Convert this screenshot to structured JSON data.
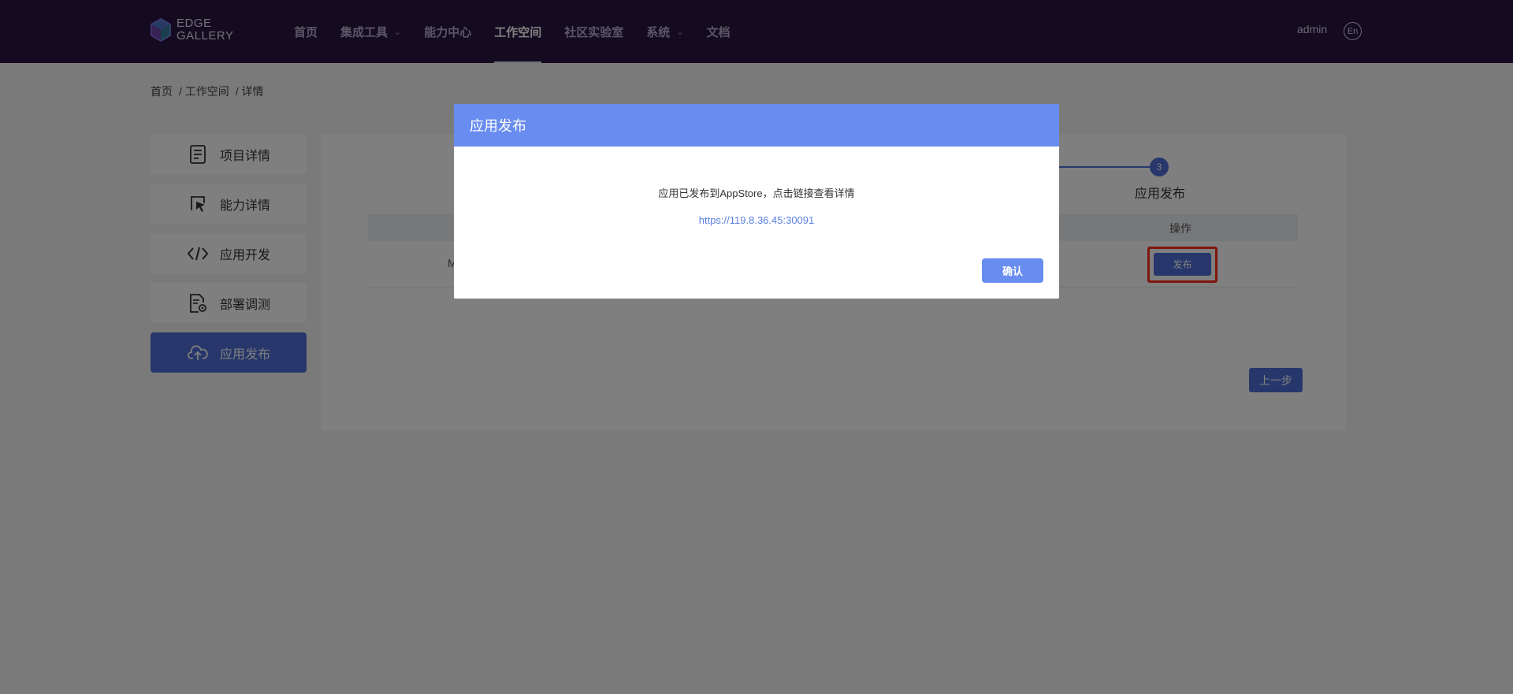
{
  "header": {
    "logo_line1": "EDGE",
    "logo_line2": "GALLERY",
    "nav": [
      {
        "label": "首页"
      },
      {
        "label": "集成工具",
        "has_dropdown": true
      },
      {
        "label": "能力中心"
      },
      {
        "label": "工作空间",
        "active": true
      },
      {
        "label": "社区实验室"
      },
      {
        "label": "系统",
        "has_dropdown": true
      },
      {
        "label": "文档"
      }
    ],
    "user": "admin",
    "lang": "En"
  },
  "breadcrumb": [
    "首页",
    "/ 工作空间",
    "/ 详情"
  ],
  "sidebar": {
    "items": [
      {
        "label": "项目详情",
        "icon": "document-icon"
      },
      {
        "label": "能力详情",
        "icon": "cursor-icon"
      },
      {
        "label": "应用开发",
        "icon": "code-icon"
      },
      {
        "label": "部署调测",
        "icon": "file-settings-icon"
      },
      {
        "label": "应用发布",
        "icon": "cloud-upload-icon",
        "active": true
      }
    ]
  },
  "main": {
    "step_number": "3",
    "step_label": "应用发布",
    "table": {
      "op_header": "操作",
      "row_cell": "M",
      "publish_label": "发布"
    },
    "prev_label": "上一步"
  },
  "dialog": {
    "title": "应用发布",
    "message": "应用已发布到AppStore，点击链接查看详情",
    "link": "https://119.8.36.45:30091",
    "confirm_label": "确认"
  },
  "colors": {
    "header_bg": "#281743",
    "accent": "#4f6fd6",
    "dialog_accent": "#688cf0",
    "highlight": "#ff2a1a"
  }
}
